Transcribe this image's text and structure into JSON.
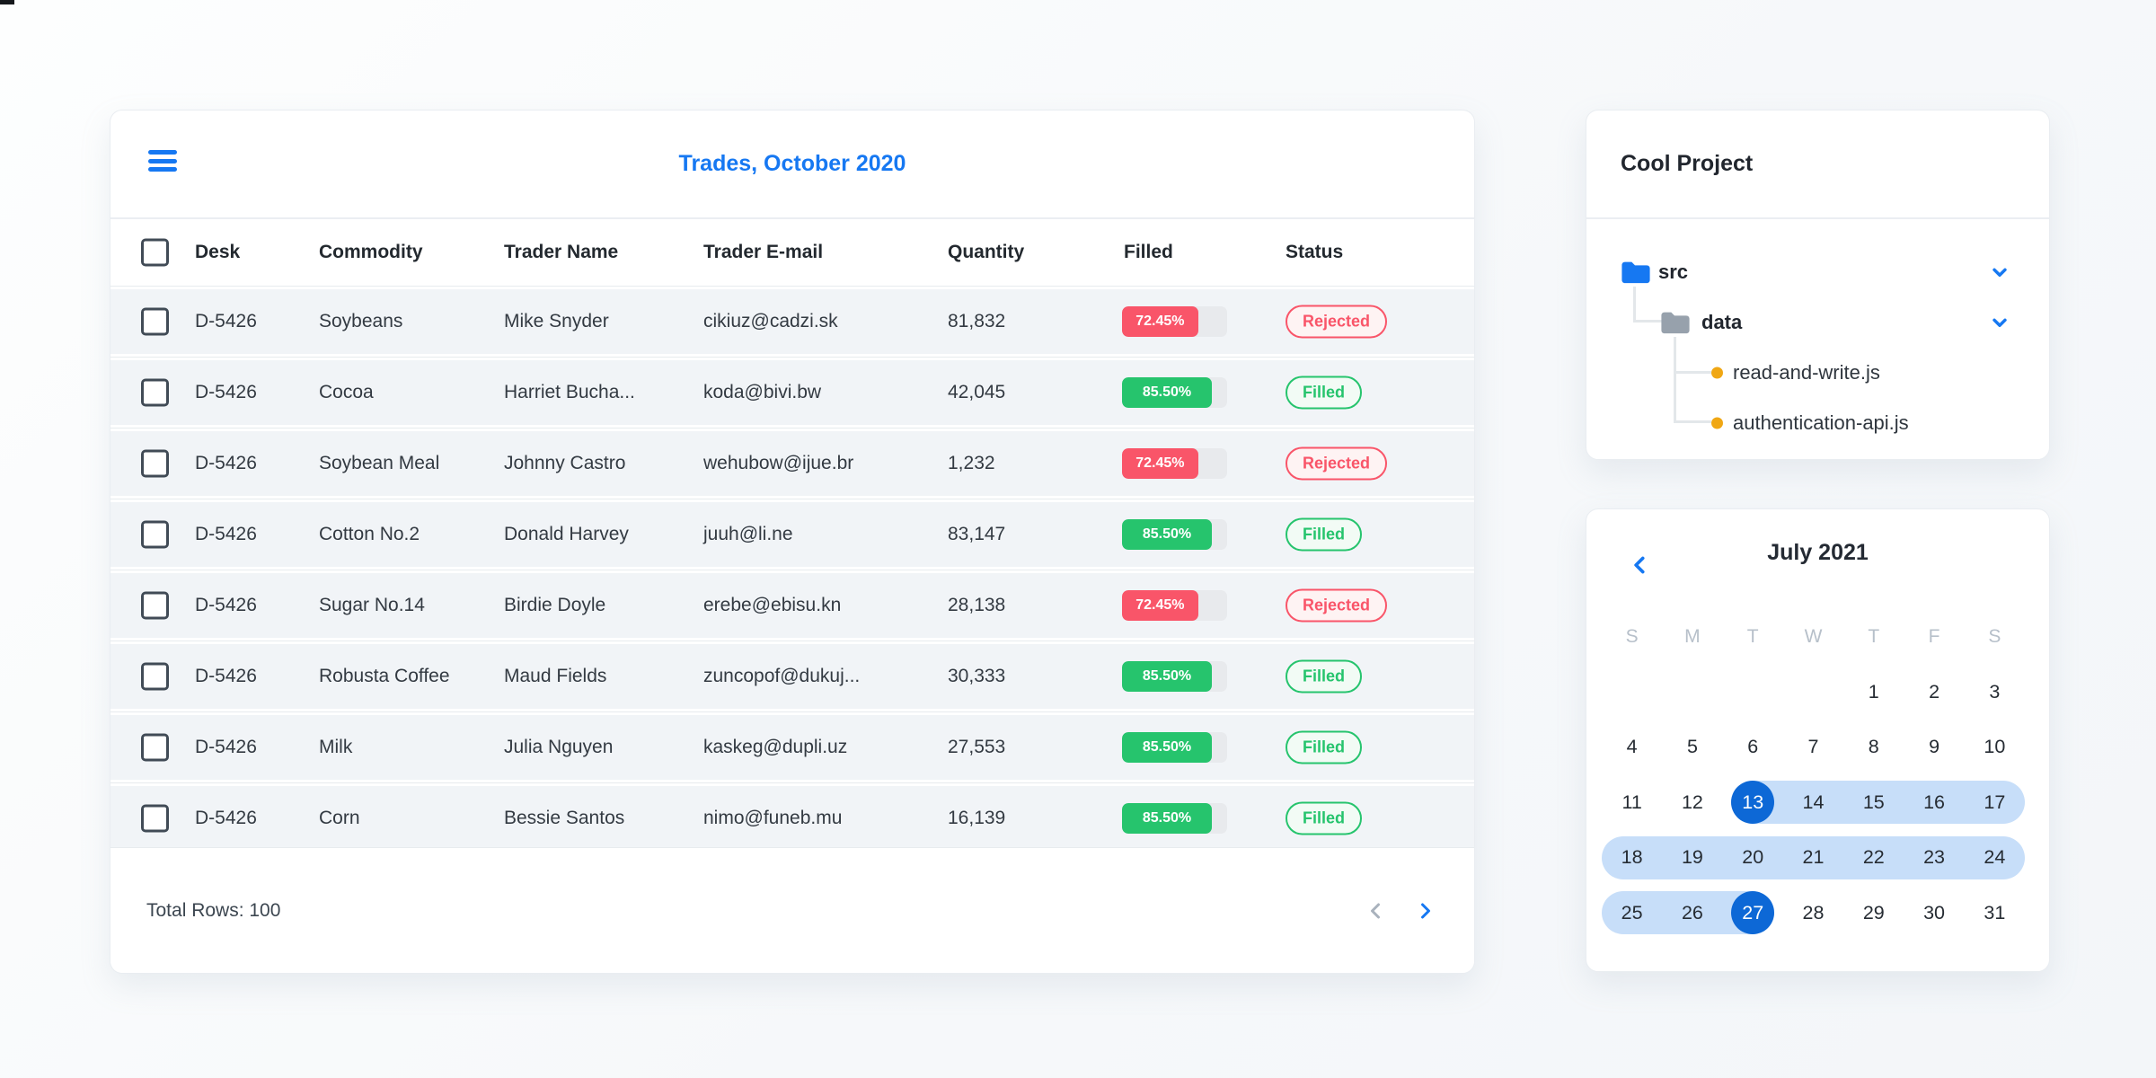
{
  "trades_panel": {
    "title": "Trades, October 2020",
    "columns": {
      "desk": "Desk",
      "commodity": "Commodity",
      "trader": "Trader Name",
      "email": "Trader E-mail",
      "quantity": "Quantity",
      "filled": "Filled",
      "status": "Status"
    },
    "rows": [
      {
        "desk": "D-5426",
        "commodity": "Soybeans",
        "trader": "Mike Snyder",
        "email": "cikiuz@cadzi.sk",
        "quantity": "81,832",
        "filled": "72.45%",
        "filled_pct": 72.45,
        "status": "Rejected"
      },
      {
        "desk": "D-5426",
        "commodity": "Cocoa",
        "trader": "Harriet Bucha...",
        "email": "koda@bivi.bw",
        "quantity": "42,045",
        "filled": "85.50%",
        "filled_pct": 85.5,
        "status": "Filled"
      },
      {
        "desk": "D-5426",
        "commodity": "Soybean Meal",
        "trader": "Johnny Castro",
        "email": "wehubow@ijue.br",
        "quantity": "1,232",
        "filled": "72.45%",
        "filled_pct": 72.45,
        "status": "Rejected"
      },
      {
        "desk": "D-5426",
        "commodity": "Cotton No.2",
        "trader": "Donald Harvey",
        "email": "juuh@li.ne",
        "quantity": "83,147",
        "filled": "85.50%",
        "filled_pct": 85.5,
        "status": "Filled"
      },
      {
        "desk": "D-5426",
        "commodity": "Sugar No.14",
        "trader": "Birdie Doyle",
        "email": "erebe@ebisu.kn",
        "quantity": "28,138",
        "filled": "72.45%",
        "filled_pct": 72.45,
        "status": "Rejected"
      },
      {
        "desk": "D-5426",
        "commodity": "Robusta Coffee",
        "trader": "Maud Fields",
        "email": "zuncopof@dukuj...",
        "quantity": "30,333",
        "filled": "85.50%",
        "filled_pct": 85.5,
        "status": "Filled"
      },
      {
        "desk": "D-5426",
        "commodity": "Milk",
        "trader": "Julia Nguyen",
        "email": "kaskeg@dupli.uz",
        "quantity": "27,553",
        "filled": "85.50%",
        "filled_pct": 85.5,
        "status": "Filled"
      },
      {
        "desk": "D-5426",
        "commodity": "Corn",
        "trader": "Bessie Santos",
        "email": "nimo@funeb.mu",
        "quantity": "16,139",
        "filled": "85.50%",
        "filled_pct": 85.5,
        "status": "Filled"
      }
    ],
    "footer_total": "Total Rows: 100"
  },
  "project_panel": {
    "title": "Cool Project",
    "src_label": "src",
    "data_label": "data",
    "file1": "read-and-write.js",
    "file2": "authentication-api.js"
  },
  "calendar_panel": {
    "title": "July 2021",
    "day_headers": [
      "S",
      "M",
      "T",
      "W",
      "T",
      "F",
      "S"
    ],
    "weeks": [
      [
        "",
        "",
        "",
        "",
        "1",
        "2",
        "3"
      ],
      [
        "4",
        "5",
        "6",
        "7",
        "8",
        "9",
        "10"
      ],
      [
        "11",
        "12",
        "13",
        "14",
        "15",
        "16",
        "17"
      ],
      [
        "18",
        "19",
        "20",
        "21",
        "22",
        "23",
        "24"
      ],
      [
        "25",
        "26",
        "27",
        "28",
        "29",
        "30",
        "31"
      ]
    ],
    "range_start": 13,
    "range_end": 27
  },
  "colors": {
    "accent_blue": "#1678f2",
    "selected_day_blue": "#0d68d6",
    "range_band_blue": "#c7def9",
    "progress_red": "#f95569",
    "progress_green": "#26c46d",
    "badge_red_bg": "#fef3f3",
    "badge_green_bg": "#f2fbf5",
    "file_dot_orange": "#f0a714",
    "folder_blue": "#1678f2",
    "folder_gray": "#97a1ac",
    "muted_gray": "#a9b2bd"
  }
}
